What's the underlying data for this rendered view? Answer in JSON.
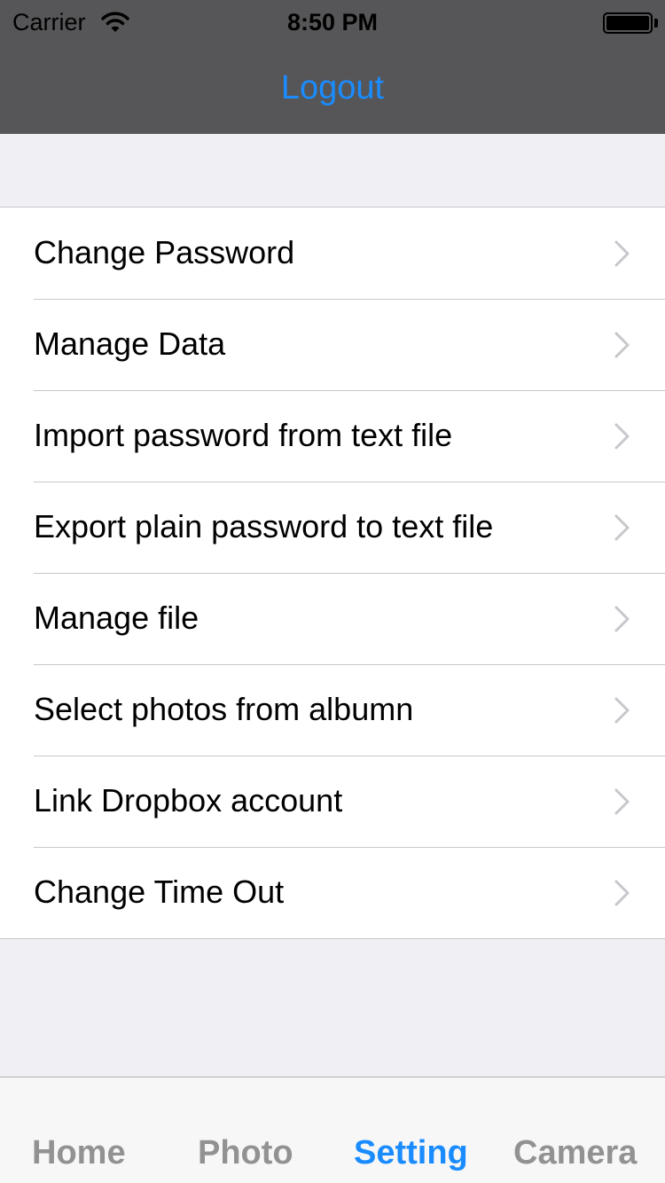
{
  "status_bar": {
    "carrier": "Carrier",
    "time": "8:50 PM"
  },
  "nav": {
    "title": "Logout"
  },
  "settings": {
    "items": [
      {
        "label": "Change Password"
      },
      {
        "label": "Manage Data"
      },
      {
        "label": "Import password from text file"
      },
      {
        "label": "Export plain password to text file"
      },
      {
        "label": "Manage file"
      },
      {
        "label": "Select photos from albumn"
      },
      {
        "label": "Link Dropbox account"
      },
      {
        "label": "Change Time Out"
      }
    ]
  },
  "tabbar": {
    "tabs": [
      {
        "label": "Home"
      },
      {
        "label": "Photo"
      },
      {
        "label": "Setting"
      },
      {
        "label": "Camera"
      }
    ],
    "active_index": 2
  },
  "colors": {
    "accent": "#1a8cff",
    "nav_background": "#565658",
    "page_background": "#efeff4",
    "inactive_tab": "#929292"
  },
  "icons": {
    "wifi": "wifi-icon",
    "battery": "battery-icon",
    "chevron": "chevron-right-icon"
  }
}
